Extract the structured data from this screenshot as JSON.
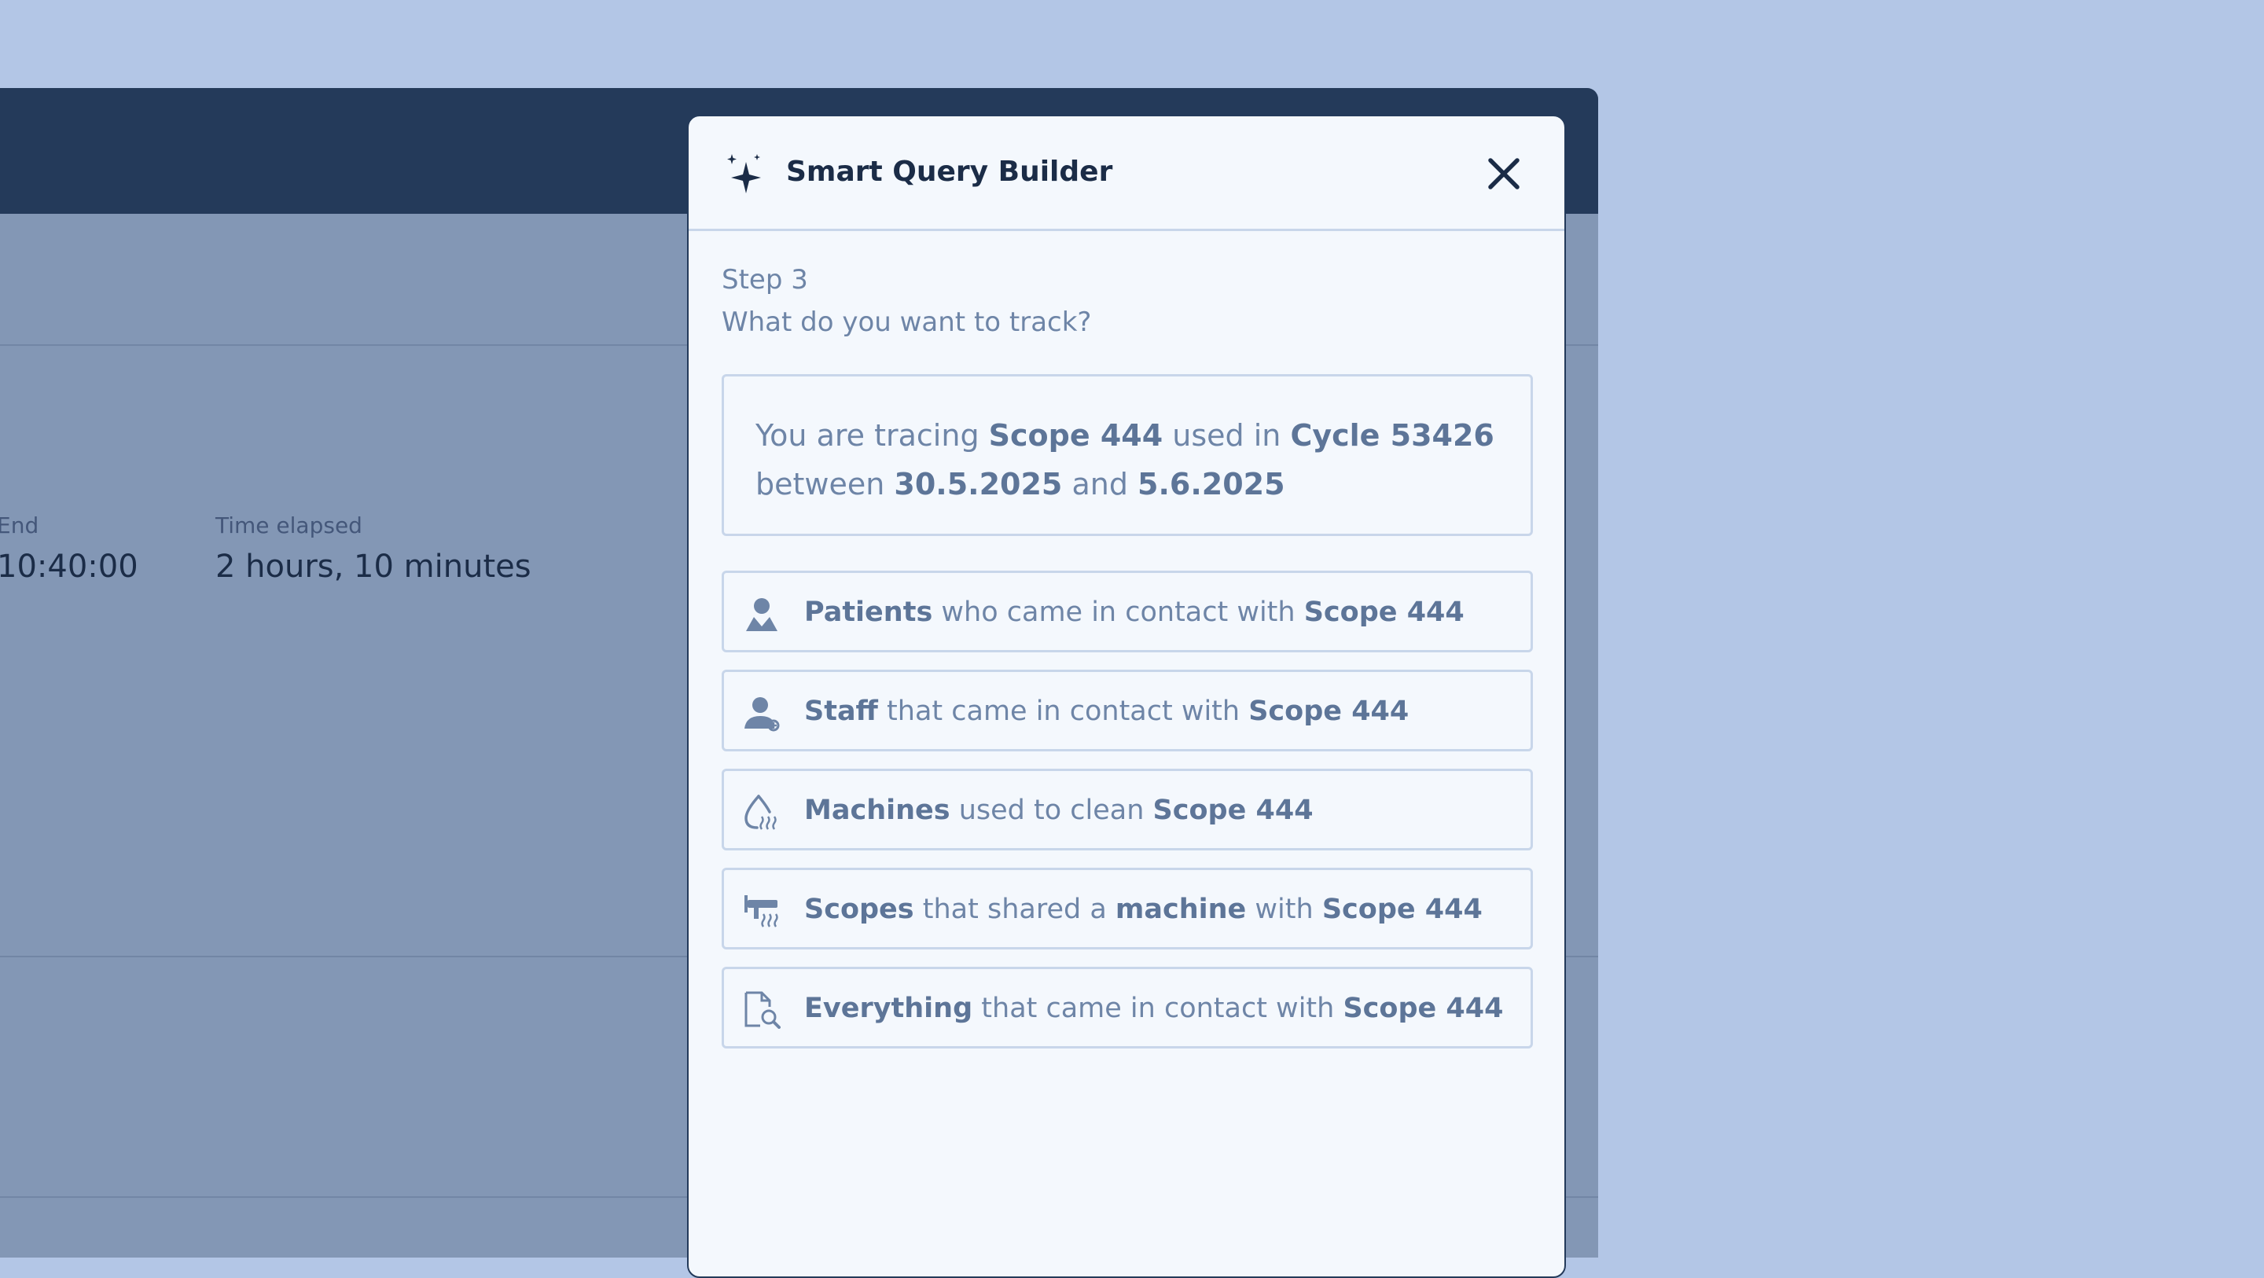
{
  "background": {
    "end_label": "End",
    "end_value": "10:40:00",
    "elapsed_label": "Time elapsed",
    "elapsed_value": "2 hours, 10 minutes"
  },
  "modal": {
    "title": "Smart Query Builder",
    "step": "Step 3",
    "question": "What do you want to track?",
    "summary": {
      "p1": "You are tracing ",
      "scope": "Scope 444",
      "p2": " used in ",
      "cycle": "Cycle 53426",
      "p3": "between ",
      "date_from": "30.5.2025",
      "p4": " and ",
      "date_to": "5.6.2025"
    },
    "options": [
      {
        "icon": "patient-icon",
        "bold": "Patients",
        "text": " who came in contact with ",
        "target": "Scope 444"
      },
      {
        "icon": "staff-icon",
        "bold": "Staff",
        "text": " that came in contact with ",
        "target": "Scope 444"
      },
      {
        "icon": "machine-icon",
        "bold": "Machines",
        "text": " used to clean ",
        "target": "Scope 444"
      },
      {
        "icon": "scopes-icon",
        "bold": "Scopes",
        "text": " that shared a ",
        "bold2": "machine",
        "text2": " with ",
        "target": "Scope 444"
      },
      {
        "icon": "document-search-icon",
        "bold": "Everything",
        "text": " that came in contact with ",
        "target": "Scope 444"
      }
    ]
  }
}
